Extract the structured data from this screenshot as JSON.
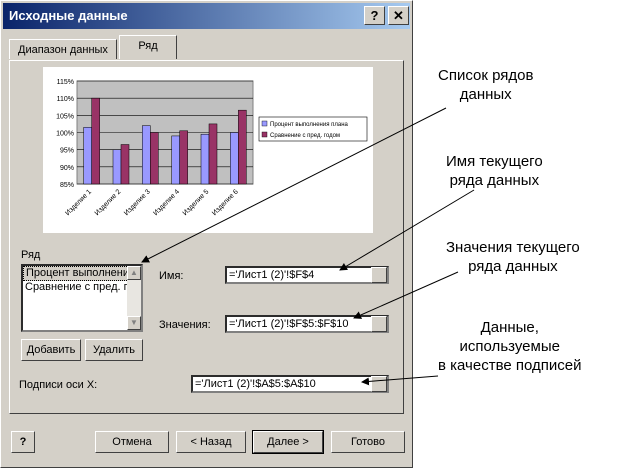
{
  "window": {
    "title": "Исходные данные",
    "help_glyph": "?",
    "close_glyph": "✕"
  },
  "tabs": [
    {
      "label": "Диапазон данных"
    },
    {
      "label": "Ряд"
    }
  ],
  "chart_data": {
    "type": "bar",
    "categories": [
      "Изделие 1",
      "Изделие 2",
      "Изделие 3",
      "Изделие 4",
      "Изделие 5",
      "Изделие 6"
    ],
    "series": [
      {
        "name": "Процент выполнения плана",
        "values": [
          101.5,
          95,
          102,
          99,
          99.5,
          100
        ],
        "color": "#9999ff"
      },
      {
        "name": "Сравнение с пред. годом",
        "values": [
          110,
          96.5,
          100,
          100.5,
          102.5,
          106.5
        ],
        "color": "#993366"
      }
    ],
    "yticks": [
      "115%",
      "110%",
      "105%",
      "100%",
      "95%",
      "90%",
      "85%"
    ],
    "ylim": [
      85,
      115
    ],
    "legend_placement": "right"
  },
  "series_panel": {
    "group_label": "Ряд",
    "items": [
      "Процент выполнения плана",
      "Сравнение с пред. годом"
    ],
    "add_button": "Добавить",
    "delete_button": "Удалить",
    "name_label": "Имя:",
    "name_value": "='Лист1 (2)'!$F$4",
    "values_label": "Значения:",
    "values_value": "='Лист1 (2)'!$F$5:$F$10",
    "xlabels_label": "Подписи оси X:",
    "xlabels_value": "='Лист1 (2)'!$A$5:$A$10"
  },
  "footer": {
    "cancel": "Отмена",
    "back": "< Назад",
    "next": "Далее >",
    "finish": "Готово"
  },
  "annotations": {
    "series_list": [
      "Список рядов",
      "данных"
    ],
    "series_name": [
      "Имя текущего",
      "ряда данных"
    ],
    "series_values": [
      "Значения текущего",
      "ряда данных"
    ],
    "axis_labels": [
      "Данные,",
      "используемые",
      "в качестве подписей"
    ]
  }
}
